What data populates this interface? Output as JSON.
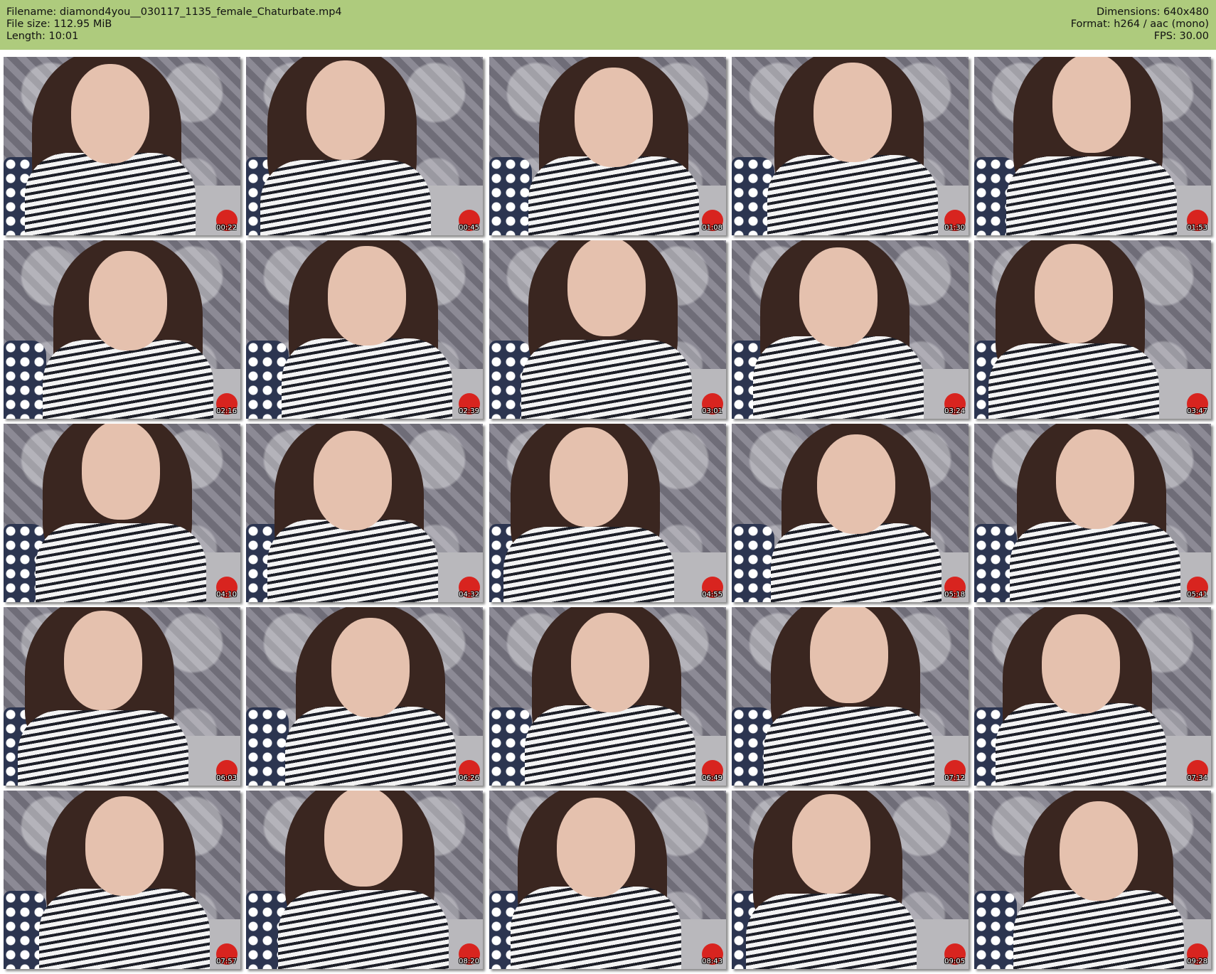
{
  "header": {
    "filename": "Filename: diamond4you__030117_1135_female_Chaturbate.mp4",
    "filesize": "File size: 112.95 MiB",
    "length": "Length: 10:01",
    "dimensions": "Dimensions: 640x480",
    "format": "Format: h264 / aac (mono)",
    "fps": "FPS: 30.00"
  },
  "colors": {
    "header_bg": "#aecb7d",
    "page_bg": "#ffffff"
  },
  "thumbnails": [
    {
      "timestamp": "00:22"
    },
    {
      "timestamp": "00:45"
    },
    {
      "timestamp": "01:08"
    },
    {
      "timestamp": "01:30"
    },
    {
      "timestamp": "01:53"
    },
    {
      "timestamp": "02:16"
    },
    {
      "timestamp": "02:39"
    },
    {
      "timestamp": "03:01"
    },
    {
      "timestamp": "03:24"
    },
    {
      "timestamp": "03:47"
    },
    {
      "timestamp": "04:10"
    },
    {
      "timestamp": "04:32"
    },
    {
      "timestamp": "04:55"
    },
    {
      "timestamp": "05:18"
    },
    {
      "timestamp": "05:41"
    },
    {
      "timestamp": "06:03"
    },
    {
      "timestamp": "06:26"
    },
    {
      "timestamp": "06:49"
    },
    {
      "timestamp": "07:12"
    },
    {
      "timestamp": "07:34"
    },
    {
      "timestamp": "07:57"
    },
    {
      "timestamp": "08:20"
    },
    {
      "timestamp": "08:43"
    },
    {
      "timestamp": "09:05"
    },
    {
      "timestamp": "09:28"
    }
  ]
}
